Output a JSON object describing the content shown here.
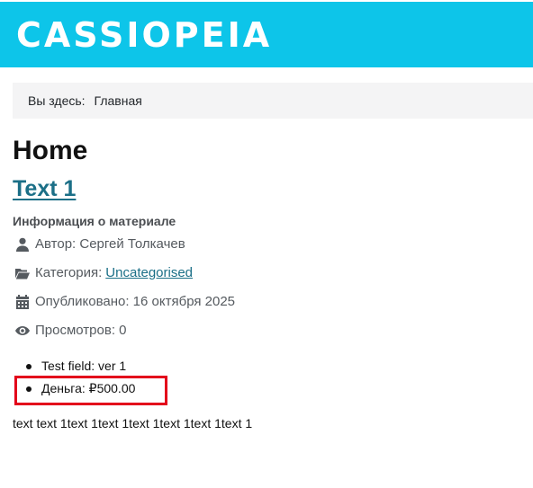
{
  "header": {
    "brand": "CASSIOPEIA",
    "brand_color": "#0dc5e9"
  },
  "breadcrumb": {
    "label": "Вы здесь:",
    "home": "Главная"
  },
  "page_title": "Home",
  "article": {
    "title": "Text 1",
    "info_heading": "Информация о материале",
    "meta": {
      "author": {
        "icon": "user-icon",
        "text": "Автор: Сергей Толкачев"
      },
      "category": {
        "icon": "folder-open-icon",
        "label": "Категория:",
        "value": "Uncategorised"
      },
      "published": {
        "icon": "calendar-icon",
        "text": "Опубликовано: 16 октября 2025"
      },
      "views": {
        "icon": "eye-icon",
        "text": "Просмотров: 0"
      }
    },
    "fields": [
      {
        "text": "Test field: ver 1"
      },
      {
        "text": "Деньга: ₽500.00"
      }
    ],
    "highlight_color": "#e3001b",
    "body": "text text 1text 1text 1text 1text 1text 1text 1"
  }
}
